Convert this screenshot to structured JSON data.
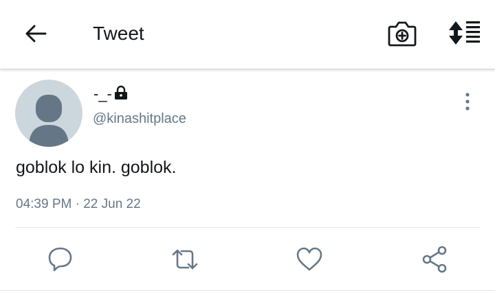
{
  "header": {
    "title": "Tweet",
    "icons": [
      "back-arrow-icon",
      "camera-add-icon",
      "sort-icon"
    ]
  },
  "tweet": {
    "display_name": "-_-",
    "handle": "@kinashitplace",
    "text": "goblok lo kin. goblok.",
    "time": "04:39 PM",
    "separator": "·",
    "date": "22 Jun 22",
    "protected": true
  },
  "actions": [
    "reply-icon",
    "retweet-icon",
    "like-icon",
    "share-icon"
  ],
  "colors": {
    "text": "#14171a",
    "secondary": "#657786",
    "avatar_bg": "#ccd6dd",
    "avatar_fg": "#657786",
    "divider": "#e1e8ed"
  }
}
